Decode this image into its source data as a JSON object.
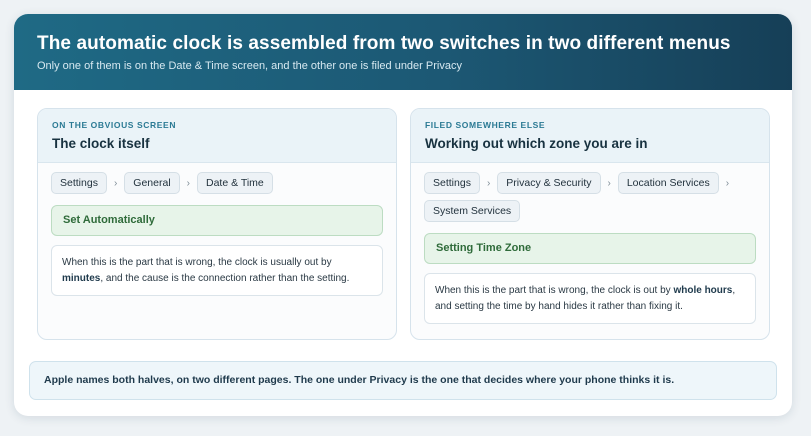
{
  "header": {
    "title": "The automatic clock is assembled from two switches in two different menus",
    "subtitle": "Only one of them is on the Date & Time screen, and the other one is filed under Privacy"
  },
  "left_panel": {
    "kicker": "ON THE OBVIOUS SCREEN",
    "title": "The clock itself",
    "path": [
      "Settings",
      "General",
      "Date & Time"
    ],
    "separator": "›",
    "toggle_label": "Set Automatically",
    "note": {
      "before": "When this is the part that is wrong, the clock is usually out by ",
      "emphasis": "minutes",
      "after": ", and the cause is the connection rather than the setting."
    }
  },
  "right_panel": {
    "kicker": "FILED SOMEWHERE ELSE",
    "title": "Working out which zone you are in",
    "path": [
      "Settings",
      "Privacy & Security",
      "Location Services",
      "System Services"
    ],
    "separator": "›",
    "toggle_label": "Setting Time Zone",
    "note": {
      "before": "When this is the part that is wrong, the clock is out by ",
      "emphasis": "whole hours",
      "after": ", and setting the time by hand hides it rather than fixing it."
    }
  },
  "footer": {
    "text": "Apple names both halves, on two different pages. The one under Privacy is the one that decides where your phone thinks it is."
  },
  "colors": {
    "header_gradient_start": "#1f6a85",
    "header_gradient_end": "#163f57",
    "kicker": "#2b7a94",
    "toggle_bg": "#e7f4e9",
    "toggle_text": "#2f6b3a",
    "footer_bg": "#eef6fa"
  }
}
